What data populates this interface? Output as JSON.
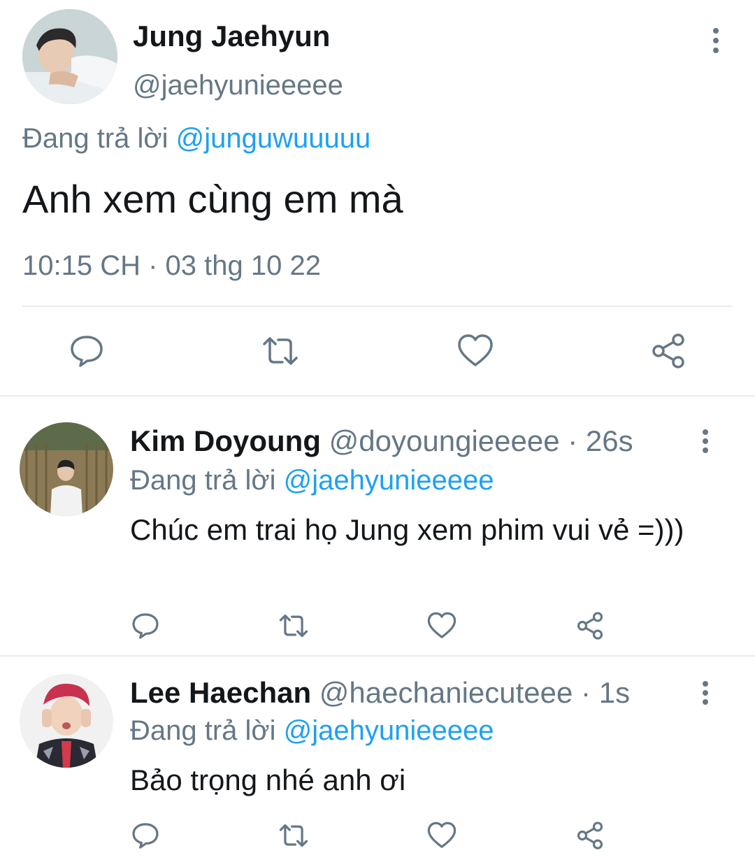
{
  "main_tweet": {
    "author_name": "Jung Jaehyun",
    "author_handle": "@jaehyunieeeee",
    "replying_prefix": "Đang trả lời",
    "replying_to": "@junguwuuuuu",
    "text": "Anh xem cùng em mà",
    "timestamp": "10:15 CH · 03 thg 10 22",
    "icons": [
      "more-vertical-icon",
      "reply-icon",
      "retweet-icon",
      "like-icon",
      "share-icon"
    ]
  },
  "replies": [
    {
      "author_name": "Kim Doyoung",
      "author_handle": "@doyoungieeeee",
      "separator": "·",
      "age": "26s",
      "replying_prefix": "Đang trả lời",
      "replying_to": "@jaehyunieeeee",
      "text": "Chúc em trai họ Jung xem phim vui vẻ =)))"
    },
    {
      "author_name": "Lee Haechan",
      "author_handle": "@haechaniecuteee",
      "separator": "·",
      "age": "1s",
      "replying_prefix": "Đang trả lời",
      "replying_to": "@jaehyunieeeee",
      "text": "Bảo trọng nhé anh ơi"
    }
  ],
  "colors": {
    "text": "#14171a",
    "secondary": "#657786",
    "accent": "#1da1f2",
    "divider": "#e6ecf0"
  }
}
